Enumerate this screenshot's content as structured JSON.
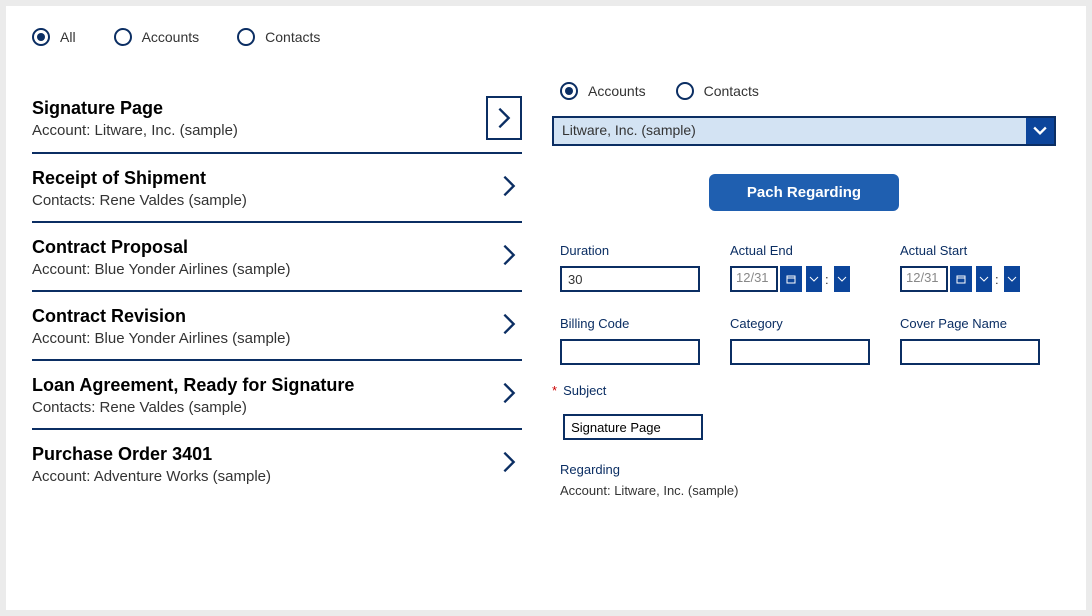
{
  "top_filters": {
    "all": "All",
    "accounts": "Accounts",
    "contacts": "Contacts",
    "selected": "all"
  },
  "list": [
    {
      "title": "Signature Page",
      "sub": "Account: Litware, Inc. (sample)",
      "selected": true
    },
    {
      "title": "Receipt of Shipment",
      "sub": "Contacts: Rene Valdes (sample)",
      "selected": false
    },
    {
      "title": "Contract Proposal",
      "sub": "Account: Blue Yonder Airlines (sample)",
      "selected": false
    },
    {
      "title": "Contract Revision",
      "sub": "Account: Blue Yonder Airlines (sample)",
      "selected": false
    },
    {
      "title": "Loan Agreement, Ready for Signature",
      "sub": "Contacts: Rene Valdes (sample)",
      "selected": false
    },
    {
      "title": "Purchase Order 3401",
      "sub": "Account: Adventure Works (sample)",
      "selected": false
    }
  ],
  "right_filters": {
    "accounts": "Accounts",
    "contacts": "Contacts",
    "selected": "accounts"
  },
  "dropdown_value": "Litware, Inc. (sample)",
  "primary_button": "Pach Regarding",
  "fields": {
    "duration": {
      "label": "Duration",
      "value": "30"
    },
    "actual_end": {
      "label": "Actual End",
      "value": "12/31"
    },
    "actual_start": {
      "label": "Actual Start",
      "value": "12/31"
    },
    "billing_code": {
      "label": "Billing Code",
      "value": ""
    },
    "category": {
      "label": "Category",
      "value": ""
    },
    "cover_page": {
      "label": "Cover Page Name",
      "value": ""
    },
    "subject": {
      "label": "Subject",
      "value": "Signature Page"
    }
  },
  "regarding": {
    "label": "Regarding",
    "value": "Account: Litware, Inc. (sample)"
  }
}
